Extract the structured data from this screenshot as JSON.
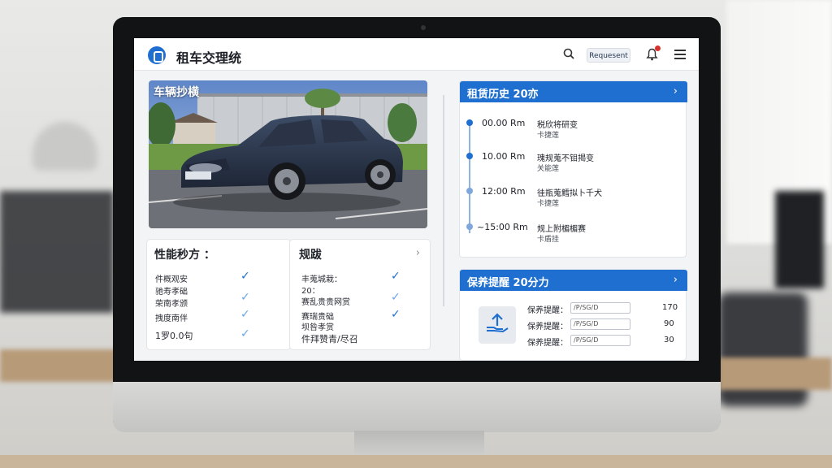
{
  "app": {
    "title": "租车交理统"
  },
  "header": {
    "button_label": "Requesent"
  },
  "vehicle_photo": {
    "label": "车辆抄横"
  },
  "performance_card": {
    "title": "性能秒方 ：",
    "rows": [
      "件概观安",
      "驰寿孝础",
      "荣南孝颁",
      "拽度南伴",
      "1罗0.0句"
    ]
  },
  "extras_card": {
    "title": "规跋",
    "rows": [
      "丰蒐城栽：",
      "20：",
      "赛乱贵贵网赏",
      "赛瑞贵础",
      "坝咎孝赏",
      "件拜赞青/尽召"
    ]
  },
  "history_card": {
    "title": "租赁历史  20亦",
    "entries": [
      {
        "time": "00.00 Rm",
        "line1": "税欣将研变",
        "line2": "卡捷莲"
      },
      {
        "time": "10.00 Rm",
        "line1": "瑰规蒐不钼揭变",
        "line2": "关能莲"
      },
      {
        "time": "12:00 Rm",
        "line1": "徍瓶蒐鳕拟卜千犬",
        "line2": "卡捷莲"
      },
      {
        "time": "~15:00 Rm",
        "line1": "规上附楣楣赛",
        "line2": "卡盾挂"
      }
    ]
  },
  "maintenance_card": {
    "title": "保养提醒  20分力",
    "rows": [
      {
        "label": "保养提醒：",
        "field": "/P/SG/D",
        "value": "170"
      },
      {
        "label": "保养提醒：",
        "field": "/P/SG/D",
        "value": "90"
      },
      {
        "label": "保养提醒：",
        "field": "/P/SG/D",
        "value": "30"
      }
    ]
  },
  "colors": {
    "accent": "#1f6fd1",
    "alert": "#d8302c"
  },
  "icons": [
    "logo-icon",
    "search-icon",
    "bell-icon",
    "menu-icon",
    "chevron-right-icon",
    "check-icon",
    "upload-icon"
  ]
}
